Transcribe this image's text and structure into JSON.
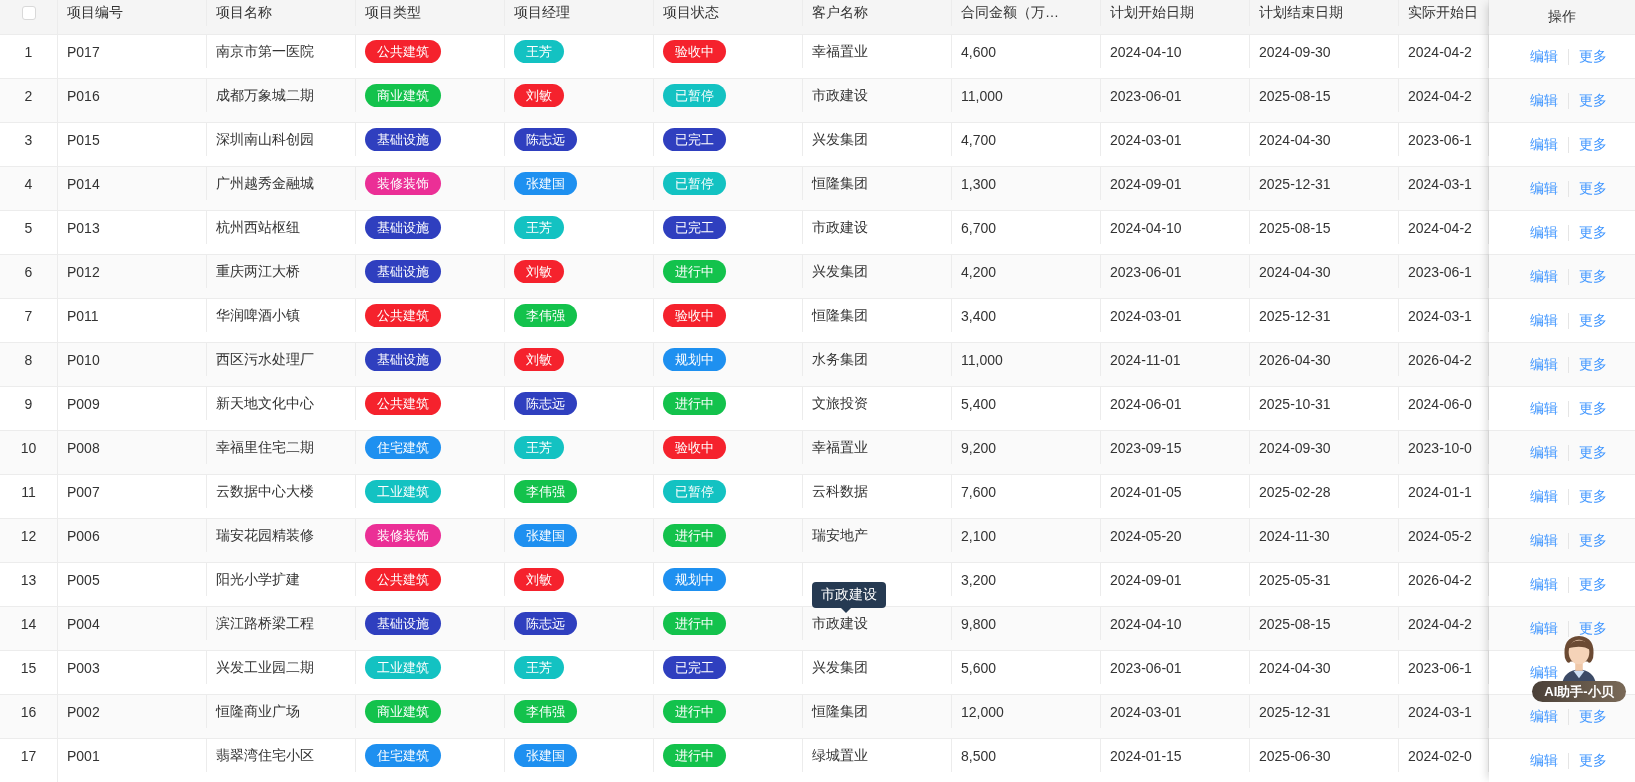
{
  "table": {
    "select_all": {
      "checked": false
    },
    "columns": [
      "项目编号",
      "项目名称",
      "项目类型",
      "项目经理",
      "项目状态",
      "客户名称",
      "合同金额（万…",
      "计划开始日期",
      "计划结束日期",
      "实际开始日"
    ],
    "action_column": "操作",
    "rows": [
      {
        "index": "1",
        "code": "P017",
        "name": "南京市第一医院",
        "type": {
          "text": "公共建筑",
          "color": "#f5222d"
        },
        "manager": {
          "text": "王芳",
          "color": "#13c2c2"
        },
        "status": {
          "text": "验收中",
          "color": "#f5222d"
        },
        "customer": "幸福置业",
        "amount": "4,600",
        "plan_start": "2024-04-10",
        "plan_end": "2024-09-30",
        "actual_start": "2024-04-2",
        "actions": [
          "编辑",
          "更多"
        ]
      },
      {
        "index": "2",
        "code": "P016",
        "name": "成都万象城二期",
        "type": {
          "text": "商业建筑",
          "color": "#13c24c"
        },
        "manager": {
          "text": "刘敏",
          "color": "#f5222d"
        },
        "status": {
          "text": "已暂停",
          "color": "#13c2c2"
        },
        "customer": "市政建设",
        "amount": "11,000",
        "plan_start": "2023-06-01",
        "plan_end": "2025-08-15",
        "actual_start": "2024-04-2",
        "actions": [
          "编辑",
          "更多"
        ]
      },
      {
        "index": "3",
        "code": "P015",
        "name": "深圳南山科创园",
        "type": {
          "text": "基础设施",
          "color": "#2f3fbf"
        },
        "manager": {
          "text": "陈志远",
          "color": "#2f3fbf"
        },
        "status": {
          "text": "已完工",
          "color": "#2f3fbf"
        },
        "customer": "兴发集团",
        "amount": "4,700",
        "plan_start": "2024-03-01",
        "plan_end": "2024-04-30",
        "actual_start": "2023-06-1",
        "actions": [
          "编辑",
          "更多"
        ]
      },
      {
        "index": "4",
        "code": "P014",
        "name": "广州越秀金融城",
        "type": {
          "text": "装修装饰",
          "color": "#eb2f96"
        },
        "manager": {
          "text": "张建国",
          "color": "#1e90f0"
        },
        "status": {
          "text": "已暂停",
          "color": "#13c2c2"
        },
        "customer": "恒隆集团",
        "amount": "1,300",
        "plan_start": "2024-09-01",
        "plan_end": "2025-12-31",
        "actual_start": "2024-03-1",
        "actions": [
          "编辑",
          "更多"
        ]
      },
      {
        "index": "5",
        "code": "P013",
        "name": "杭州西站枢纽",
        "type": {
          "text": "基础设施",
          "color": "#2f3fbf"
        },
        "manager": {
          "text": "王芳",
          "color": "#13c2c2"
        },
        "status": {
          "text": "已完工",
          "color": "#2f3fbf"
        },
        "customer": "市政建设",
        "amount": "6,700",
        "plan_start": "2024-04-10",
        "plan_end": "2025-08-15",
        "actual_start": "2024-04-2",
        "actions": [
          "编辑",
          "更多"
        ]
      },
      {
        "index": "6",
        "code": "P012",
        "name": "重庆两江大桥",
        "type": {
          "text": "基础设施",
          "color": "#2f3fbf"
        },
        "manager": {
          "text": "刘敏",
          "color": "#f5222d"
        },
        "status": {
          "text": "进行中",
          "color": "#13c24c"
        },
        "customer": "兴发集团",
        "amount": "4,200",
        "plan_start": "2023-06-01",
        "plan_end": "2024-04-30",
        "actual_start": "2023-06-1",
        "actions": [
          "编辑",
          "更多"
        ]
      },
      {
        "index": "7",
        "code": "P011",
        "name": "华润啤酒小镇",
        "type": {
          "text": "公共建筑",
          "color": "#f5222d"
        },
        "manager": {
          "text": "李伟强",
          "color": "#13c24c"
        },
        "status": {
          "text": "验收中",
          "color": "#f5222d"
        },
        "customer": "恒隆集团",
        "amount": "3,400",
        "plan_start": "2024-03-01",
        "plan_end": "2025-12-31",
        "actual_start": "2024-03-1",
        "actions": [
          "编辑",
          "更多"
        ]
      },
      {
        "index": "8",
        "code": "P010",
        "name": "西区污水处理厂",
        "type": {
          "text": "基础设施",
          "color": "#2f3fbf"
        },
        "manager": {
          "text": "刘敏",
          "color": "#f5222d"
        },
        "status": {
          "text": "规划中",
          "color": "#1e90f0"
        },
        "customer": "水务集团",
        "amount": "11,000",
        "plan_start": "2024-11-01",
        "plan_end": "2026-04-30",
        "actual_start": "2026-04-2",
        "actions": [
          "编辑",
          "更多"
        ]
      },
      {
        "index": "9",
        "code": "P009",
        "name": "新天地文化中心",
        "type": {
          "text": "公共建筑",
          "color": "#f5222d"
        },
        "manager": {
          "text": "陈志远",
          "color": "#2f3fbf"
        },
        "status": {
          "text": "进行中",
          "color": "#13c24c"
        },
        "customer": "文旅投资",
        "amount": "5,400",
        "plan_start": "2024-06-01",
        "plan_end": "2025-10-31",
        "actual_start": "2024-06-0",
        "actions": [
          "编辑",
          "更多"
        ]
      },
      {
        "index": "10",
        "code": "P008",
        "name": "幸福里住宅二期",
        "type": {
          "text": "住宅建筑",
          "color": "#1e90f0"
        },
        "manager": {
          "text": "王芳",
          "color": "#13c2c2"
        },
        "status": {
          "text": "验收中",
          "color": "#f5222d"
        },
        "customer": "幸福置业",
        "amount": "9,200",
        "plan_start": "2023-09-15",
        "plan_end": "2024-09-30",
        "actual_start": "2023-10-0",
        "actions": [
          "编辑",
          "更多"
        ]
      },
      {
        "index": "11",
        "code": "P007",
        "name": "云数据中心大楼",
        "type": {
          "text": "工业建筑",
          "color": "#13c2c2"
        },
        "manager": {
          "text": "李伟强",
          "color": "#13c24c"
        },
        "status": {
          "text": "已暂停",
          "color": "#13c2c2"
        },
        "customer": "云科数据",
        "amount": "7,600",
        "plan_start": "2024-01-05",
        "plan_end": "2025-02-28",
        "actual_start": "2024-01-1",
        "actions": [
          "编辑",
          "更多"
        ]
      },
      {
        "index": "12",
        "code": "P006",
        "name": "瑞安花园精装修",
        "type": {
          "text": "装修装饰",
          "color": "#eb2f96"
        },
        "manager": {
          "text": "张建国",
          "color": "#1e90f0"
        },
        "status": {
          "text": "进行中",
          "color": "#13c24c"
        },
        "customer": "瑞安地产",
        "amount": "2,100",
        "plan_start": "2024-05-20",
        "plan_end": "2024-11-30",
        "actual_start": "2024-05-2",
        "actions": [
          "编辑",
          "更多"
        ]
      },
      {
        "index": "13",
        "code": "P005",
        "name": "阳光小学扩建",
        "type": {
          "text": "公共建筑",
          "color": "#f5222d"
        },
        "manager": {
          "text": "刘敏",
          "color": "#f5222d"
        },
        "status": {
          "text": "规划中",
          "color": "#1e90f0"
        },
        "amount": "3,200",
        "plan_start": "2024-09-01",
        "plan_end": "2025-05-31",
        "actual_start": "2026-04-2",
        "actions": [
          "编辑",
          "更多"
        ]
      },
      {
        "index": "14",
        "code": "P004",
        "name": "滨江路桥梁工程",
        "type": {
          "text": "基础设施",
          "color": "#2f3fbf"
        },
        "manager": {
          "text": "陈志远",
          "color": "#2f3fbf"
        },
        "status": {
          "text": "进行中",
          "color": "#13c24c"
        },
        "customer": "市政建设",
        "amount": "9,800",
        "plan_start": "2024-04-10",
        "plan_end": "2025-08-15",
        "actual_start": "2024-04-2",
        "actions": [
          "编辑",
          "更多"
        ]
      },
      {
        "index": "15",
        "code": "P003",
        "name": "兴发工业园二期",
        "type": {
          "text": "工业建筑",
          "color": "#13c2c2"
        },
        "manager": {
          "text": "王芳",
          "color": "#13c2c2"
        },
        "status": {
          "text": "已完工",
          "color": "#2f3fbf"
        },
        "customer": "兴发集团",
        "amount": "5,600",
        "plan_start": "2023-06-01",
        "plan_end": "2024-04-30",
        "actual_start": "2023-06-1",
        "actions": [
          "编辑"
        ]
      },
      {
        "index": "16",
        "code": "P002",
        "name": "恒隆商业广场",
        "type": {
          "text": "商业建筑",
          "color": "#13c24c"
        },
        "manager": {
          "text": "李伟强",
          "color": "#13c24c"
        },
        "status": {
          "text": "进行中",
          "color": "#13c24c"
        },
        "customer": "恒隆集团",
        "amount": "12,000",
        "plan_start": "2024-03-01",
        "plan_end": "2025-12-31",
        "actual_start": "2024-03-1",
        "actions": [
          "编辑",
          "更多"
        ]
      },
      {
        "index": "17",
        "code": "P001",
        "name": "翡翠湾住宅小区",
        "type": {
          "text": "住宅建筑",
          "color": "#1e90f0"
        },
        "manager": {
          "text": "张建国",
          "color": "#1e90f0"
        },
        "status": {
          "text": "进行中",
          "color": "#13c24c"
        },
        "customer": "绿城置业",
        "amount": "8,500",
        "plan_start": "2024-01-15",
        "plan_end": "2025-06-30",
        "actual_start": "2024-02-0",
        "actions": [
          "编辑",
          "更多"
        ]
      }
    ]
  },
  "tooltip": {
    "text": "市政建设"
  },
  "assistant": {
    "label": "AI助手-小贝"
  }
}
